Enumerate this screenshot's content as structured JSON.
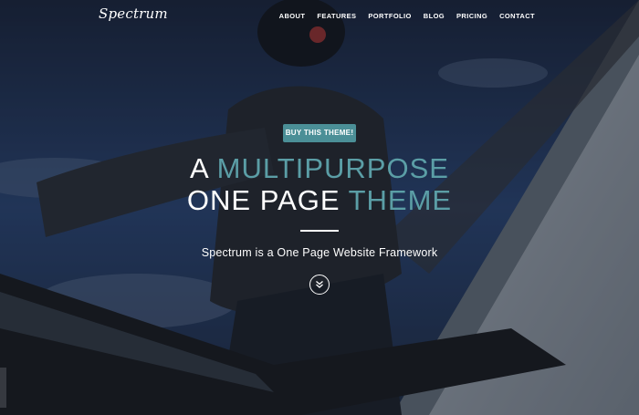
{
  "brand": {
    "logo": "Spectrum"
  },
  "nav": {
    "items": [
      {
        "label": "ABOUT"
      },
      {
        "label": "FEATURES"
      },
      {
        "label": "PORTFOLIO"
      },
      {
        "label": "BLOG"
      },
      {
        "label": "PRICING"
      },
      {
        "label": "CONTACT"
      }
    ]
  },
  "hero": {
    "buy_label": "BUY THIS THEME!",
    "headline_line1_plain": "A ",
    "headline_line1_accent": "MULTIPURPOSE",
    "headline_line2_plain": "ONE PAGE ",
    "headline_line2_accent": "THEME",
    "subtitle": "Spectrum is a One Page Website Framework",
    "scroll_icon": "double-chevron-down-icon",
    "background_image": "snowboarder-on-snowy-mountain"
  },
  "colors": {
    "accent": "#5b9ea6",
    "button": "#4b8f97",
    "text": "#ffffff"
  }
}
